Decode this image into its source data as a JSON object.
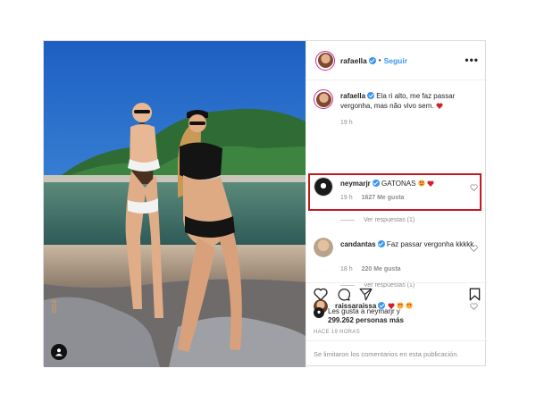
{
  "post": {
    "author": "rafaella",
    "separator": "•",
    "follow_label": "Seguir",
    "more_label": "•••"
  },
  "comments": [
    {
      "user": "rafaella",
      "text": "Ela ri alto, me faz passar vergonha, mas não vivo sem.",
      "time": "19 h"
    },
    {
      "user": "neymarjr",
      "text": "GATONAS",
      "time": "19 h",
      "likes": "1627 Me gusta",
      "replies": "Ver respuestas (1)"
    },
    {
      "user": "candantas",
      "text": "Faz passar vergonha kkkkk",
      "time": "18 h",
      "likes": "220 Me gusta",
      "replies": "Ver respuestas (1)"
    },
    {
      "user": "raissaraissa",
      "text": ""
    }
  ],
  "likes": {
    "line1": "Les gusta a neymarjr y",
    "line2": "299.262 personas más"
  },
  "time_ago": "HACE 19 HORAS",
  "comments_disabled": "Se limitaron los comentarios en esta publicación.",
  "icons": {
    "like": "heart-outline-icon",
    "comment": "comment-bubble-icon",
    "share": "paper-plane-icon",
    "save": "bookmark-icon"
  },
  "colors": {
    "verified": "#3897f0",
    "link": "#3897f0",
    "highlight": "#c4191f",
    "heart": "#ed4956"
  }
}
